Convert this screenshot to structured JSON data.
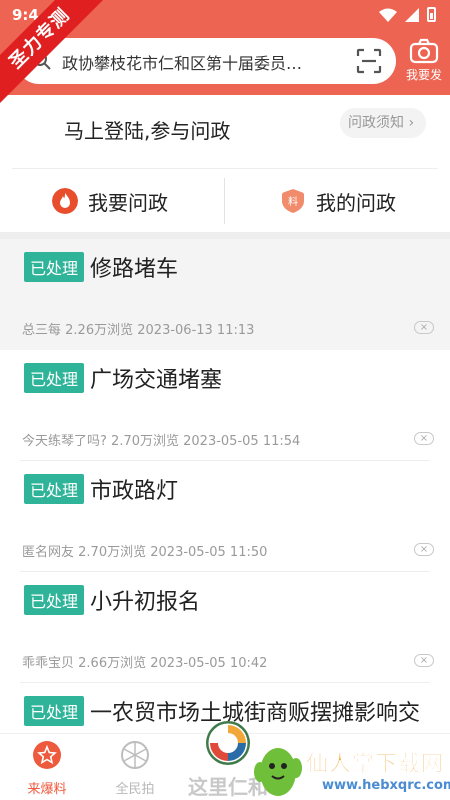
{
  "status": {
    "time": "9:4"
  },
  "ribbon": {
    "text": "圣力专测"
  },
  "search": {
    "text": "政协攀枝花市仁和区第十届委员…"
  },
  "post": {
    "label": "我要发"
  },
  "login": {
    "text": "马上登陆,参与问政",
    "notice_label": "问政须知 ›"
  },
  "ask_tabs": [
    {
      "label": "我要问政",
      "icon": "fire-icon",
      "color": "#e84e2c"
    },
    {
      "label": "我的问政",
      "icon": "shield-icon",
      "color": "#f08b6c"
    }
  ],
  "items": [
    {
      "badge": "已处理",
      "title": "修路堵车",
      "author": "总三每",
      "views": "2.26万浏览",
      "date": "2023-06-13 11:13"
    },
    {
      "badge": "已处理",
      "title": "广场交通堵塞",
      "author": "今天练琴了吗?",
      "views": "2.70万浏览",
      "date": "2023-05-05 11:54"
    },
    {
      "badge": "已处理",
      "title": "市政路灯",
      "author": "匿名网友",
      "views": "2.70万浏览",
      "date": "2023-05-05 11:50"
    },
    {
      "badge": "已处理",
      "title": "小升初报名",
      "author": "乖乖宝贝",
      "views": "2.66万浏览",
      "date": "2023-05-05 10:42"
    },
    {
      "badge": "已处理",
      "title": "一农贸市场土城街商贩摆摊影响交",
      "author": "",
      "views": "",
      "date": ""
    }
  ],
  "tabbar": {
    "tabs": [
      {
        "label": "来爆料",
        "active": true
      },
      {
        "label": "全民拍",
        "active": false
      }
    ],
    "center_label": "这里仁和"
  },
  "watermark": {
    "text": "仙人掌下载网",
    "url": "www.hebxqrc.com"
  },
  "colors": {
    "accent": "#ee6452",
    "badge": "#2fb49a",
    "active_tab": "#ee5a3d"
  }
}
